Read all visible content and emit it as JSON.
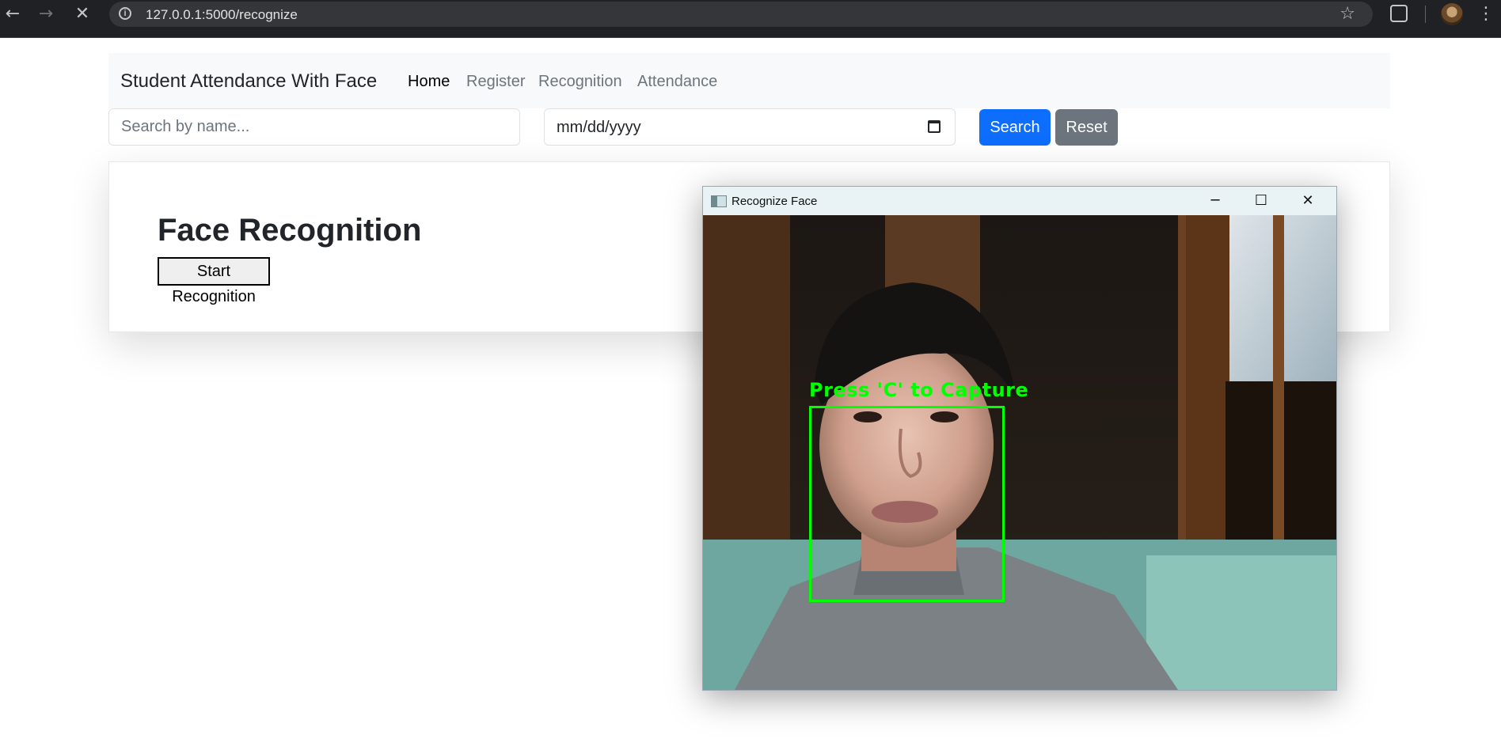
{
  "browser": {
    "url": "127.0.0.1:5000/recognize",
    "icons": [
      "back-icon",
      "forward-icon",
      "stop-loading-icon",
      "site-info-icon",
      "bookmark-star-icon",
      "extensions-icon",
      "profile-avatar",
      "menu-icon"
    ]
  },
  "navbar": {
    "brand": "Student Attendance With Face",
    "links": [
      "Home",
      "Register",
      "Recognition",
      "Attendance"
    ],
    "active": "Home"
  },
  "filters": {
    "search_placeholder": "Search by name...",
    "date_value": "mm/dd/yyyy",
    "search_button": "Search",
    "reset_button": "Reset"
  },
  "card": {
    "heading": "Face Recognition",
    "start_button": "Start Recognition"
  },
  "cv_window": {
    "title": "Recognize Face",
    "overlay_text": "Press 'C' to Capture",
    "box_color": "#00ff00"
  },
  "colors": {
    "primary": "#0d6efd",
    "secondary": "#6c757d",
    "navbar_bg": "#f8f9fa"
  }
}
